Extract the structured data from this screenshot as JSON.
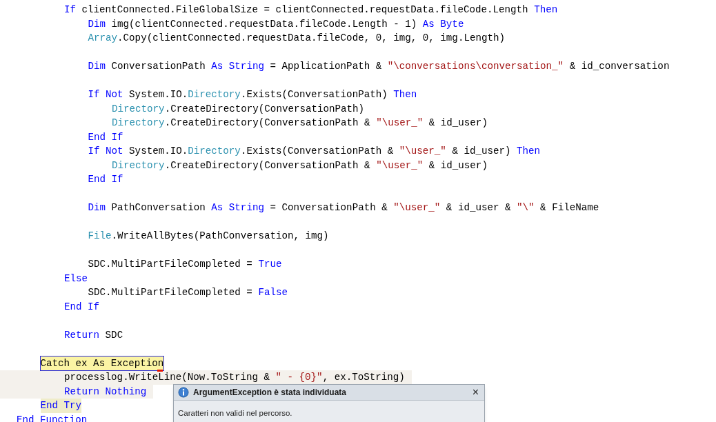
{
  "editor": {
    "lines": [
      {
        "children": [
          {
            "children": [
              {
                "tokens": [
                  {
                    "kind": "keyword",
                    "text": "If"
                  },
                  {
                    "kind": "plain",
                    "text": " clientConnected.FileGlobalSize = clientConnected.requestData.fileCode.Length "
                  },
                  {
                    "kind": "keyword",
                    "text": "Then"
                  }
                ],
                "children": [
                  {
                    "tokens": [
                      {
                        "kind": "keyword",
                        "text": "Dim"
                      },
                      {
                        "kind": "plain",
                        "text": " img(clientConnected.requestData.fileCode.Length - 1) "
                      },
                      {
                        "kind": "keyword",
                        "text": "As Byte"
                      }
                    ]
                  },
                  {
                    "tokens": [
                      {
                        "kind": "type",
                        "text": "Array"
                      },
                      {
                        "kind": "plain",
                        "text": ".Copy(clientConnected.requestData.fileCode, 0, img, 0, img.Length)"
                      }
                    ]
                  },
                  {
                    "blank": true
                  },
                  {
                    "tokens": [
                      {
                        "kind": "keyword",
                        "text": "Dim"
                      },
                      {
                        "kind": "plain",
                        "text": " ConversationPath "
                      },
                      {
                        "kind": "keyword",
                        "text": "As String"
                      },
                      {
                        "kind": "plain",
                        "text": " = ApplicationPath & "
                      },
                      {
                        "kind": "string",
                        "text": "\"\\conversations\\conversation_\""
                      },
                      {
                        "kind": "plain",
                        "text": " & id_conversation"
                      }
                    ]
                  },
                  {
                    "blank": true
                  },
                  {
                    "tokens": [
                      {
                        "kind": "keyword",
                        "text": "If Not"
                      },
                      {
                        "kind": "plain",
                        "text": " System.IO."
                      },
                      {
                        "kind": "type",
                        "text": "Directory"
                      },
                      {
                        "kind": "plain",
                        "text": ".Exists(ConversationPath) "
                      },
                      {
                        "kind": "keyword",
                        "text": "Then"
                      }
                    ],
                    "children": [
                      {
                        "tokens": [
                          {
                            "kind": "type",
                            "text": "Directory"
                          },
                          {
                            "kind": "plain",
                            "text": ".CreateDirectory(ConversationPath)"
                          }
                        ]
                      },
                      {
                        "tokens": [
                          {
                            "kind": "type",
                            "text": "Directory"
                          },
                          {
                            "kind": "plain",
                            "text": ".CreateDirectory(ConversationPath & "
                          },
                          {
                            "kind": "string",
                            "text": "\"\\user_\""
                          },
                          {
                            "kind": "plain",
                            "text": " & id_user)"
                          }
                        ]
                      }
                    ]
                  },
                  {
                    "tokens": [
                      {
                        "kind": "keyword",
                        "text": "End If"
                      }
                    ]
                  },
                  {
                    "tokens": [
                      {
                        "kind": "keyword",
                        "text": "If Not"
                      },
                      {
                        "kind": "plain",
                        "text": " System.IO."
                      },
                      {
                        "kind": "type",
                        "text": "Directory"
                      },
                      {
                        "kind": "plain",
                        "text": ".Exists(ConversationPath & "
                      },
                      {
                        "kind": "string",
                        "text": "\"\\user_\""
                      },
                      {
                        "kind": "plain",
                        "text": " & id_user) "
                      },
                      {
                        "kind": "keyword",
                        "text": "Then"
                      }
                    ],
                    "children": [
                      {
                        "tokens": [
                          {
                            "kind": "type",
                            "text": "Directory"
                          },
                          {
                            "kind": "plain",
                            "text": ".CreateDirectory(ConversationPath & "
                          },
                          {
                            "kind": "string",
                            "text": "\"\\user_\""
                          },
                          {
                            "kind": "plain",
                            "text": " & id_user)"
                          }
                        ]
                      }
                    ]
                  },
                  {
                    "tokens": [
                      {
                        "kind": "keyword",
                        "text": "End If"
                      }
                    ]
                  },
                  {
                    "blank": true
                  },
                  {
                    "tokens": [
                      {
                        "kind": "keyword",
                        "text": "Dim"
                      },
                      {
                        "kind": "plain",
                        "text": " PathConversation "
                      },
                      {
                        "kind": "keyword",
                        "text": "As String"
                      },
                      {
                        "kind": "plain",
                        "text": " = ConversationPath & "
                      },
                      {
                        "kind": "string",
                        "text": "\"\\user_\""
                      },
                      {
                        "kind": "plain",
                        "text": " & id_user & "
                      },
                      {
                        "kind": "string",
                        "text": "\"\\\""
                      },
                      {
                        "kind": "plain",
                        "text": " & FileName"
                      }
                    ]
                  },
                  {
                    "blank": true
                  },
                  {
                    "tokens": [
                      {
                        "kind": "type",
                        "text": "File"
                      },
                      {
                        "kind": "plain",
                        "text": ".WriteAllBytes(PathConversation, img)"
                      }
                    ]
                  },
                  {
                    "blank": true
                  },
                  {
                    "tokens": [
                      {
                        "kind": "plain",
                        "text": "SDC.MultiPartFileCompleted = "
                      },
                      {
                        "kind": "keyword",
                        "text": "True"
                      }
                    ]
                  }
                ]
              },
              {
                "tokens": [
                  {
                    "kind": "keyword",
                    "text": "Else"
                  }
                ],
                "children": [
                  {
                    "tokens": [
                      {
                        "kind": "plain",
                        "text": "SDC.MultiPartFileCompleted = "
                      },
                      {
                        "kind": "keyword",
                        "text": "False"
                      }
                    ]
                  }
                ]
              },
              {
                "tokens": [
                  {
                    "kind": "keyword",
                    "text": "End If"
                  }
                ]
              },
              {
                "blank": true
              },
              {
                "tokens": [
                  {
                    "kind": "keyword",
                    "text": "Return"
                  },
                  {
                    "kind": "plain",
                    "text": " SDC"
                  }
                ]
              },
              {
                "blank": true
              }
            ]
          },
          {
            "current_statement": true,
            "error_mark": true,
            "tokens": [
              {
                "kind": "plain",
                "text": "Catch ex As Exception"
              }
            ],
            "children": [
              {
                "shaded": true,
                "tokens": [
                  {
                    "kind": "plain",
                    "text": "processlog.WriteLine(Now.ToString & "
                  },
                  {
                    "kind": "string",
                    "text": "\" - {0}\""
                  },
                  {
                    "kind": "plain",
                    "text": ", ex.ToString)"
                  }
                ]
              },
              {
                "shaded": true,
                "tokens": [
                  {
                    "kind": "keyword",
                    "text": "Return Nothing"
                  }
                ]
              }
            ]
          },
          {
            "marked": true,
            "tokens": [
              {
                "kind": "keyword",
                "text": "End Try"
              }
            ]
          }
        ]
      },
      {
        "tokens": [
          {
            "kind": "keyword",
            "text": "End Function"
          }
        ]
      }
    ]
  },
  "exception_popup": {
    "title": "ArgumentException è stata individuata",
    "close": "×",
    "message": "Caratteri non validi nel percorso."
  }
}
